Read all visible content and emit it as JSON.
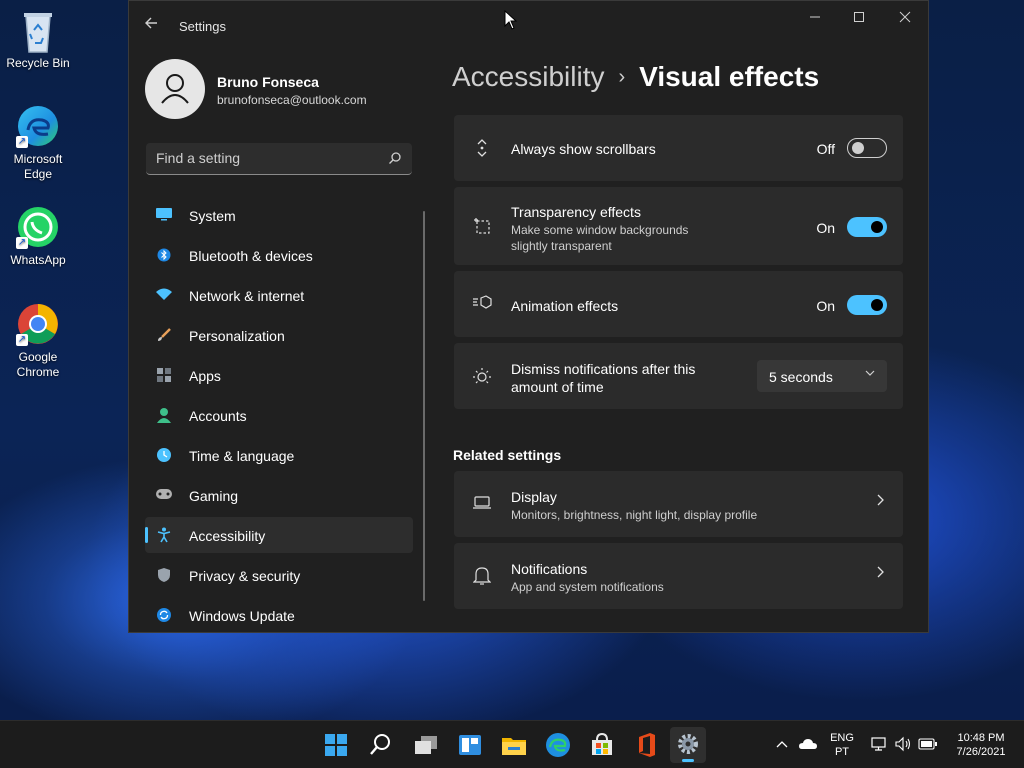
{
  "desktop": {
    "icons": [
      {
        "label": "Recycle Bin",
        "icon": "recycle-bin-icon"
      },
      {
        "label": "Microsoft Edge",
        "icon": "edge-icon"
      },
      {
        "label": "WhatsApp",
        "icon": "whatsapp-icon"
      },
      {
        "label": "Google Chrome",
        "icon": "chrome-icon"
      }
    ]
  },
  "window": {
    "title": "Settings",
    "profile": {
      "name": "Bruno Fonseca",
      "email": "brunofonseca@outlook.com"
    },
    "search": {
      "placeholder": "Find a setting"
    },
    "nav": [
      {
        "label": "System",
        "icon": "system-icon",
        "color": "#4cc2ff"
      },
      {
        "label": "Bluetooth & devices",
        "icon": "bluetooth-icon",
        "color": "#4cc2ff"
      },
      {
        "label": "Network & internet",
        "icon": "network-icon",
        "color": "#4cc2ff"
      },
      {
        "label": "Personalization",
        "icon": "personalization-icon",
        "color": "#e8a05a"
      },
      {
        "label": "Apps",
        "icon": "apps-icon",
        "color": "#9aa3ad"
      },
      {
        "label": "Accounts",
        "icon": "accounts-icon",
        "color": "#3ec08a"
      },
      {
        "label": "Time & language",
        "icon": "time-language-icon",
        "color": "#4cc2ff"
      },
      {
        "label": "Gaming",
        "icon": "gaming-icon",
        "color": "#b0b0b0"
      },
      {
        "label": "Accessibility",
        "icon": "accessibility-icon",
        "color": "#4cc2ff",
        "active": true
      },
      {
        "label": "Privacy & security",
        "icon": "privacy-icon",
        "color": "#9aa3ad"
      },
      {
        "label": "Windows Update",
        "icon": "windows-update-icon",
        "color": "#4cc2ff"
      }
    ],
    "breadcrumb": {
      "parent": "Accessibility",
      "separator": "›",
      "current": "Visual effects"
    },
    "settings": {
      "scrollbars": {
        "title": "Always show scrollbars",
        "state": "Off"
      },
      "transparency": {
        "title": "Transparency effects",
        "desc": "Make some window backgrounds slightly transparent",
        "state": "On"
      },
      "animation": {
        "title": "Animation effects",
        "state": "On"
      },
      "dismiss": {
        "title": "Dismiss notifications after this amount of time",
        "value": "5 seconds"
      }
    },
    "related": {
      "heading": "Related settings",
      "display": {
        "title": "Display",
        "desc": "Monitors, brightness, night light, display profile"
      },
      "notifications": {
        "title": "Notifications",
        "desc": "App and system notifications"
      }
    }
  },
  "taskbar": {
    "apps": [
      "start-icon",
      "search-icon",
      "task-view-icon",
      "widgets-icon",
      "file-explorer-icon",
      "edge-icon",
      "store-icon",
      "office-icon",
      "settings-icon"
    ],
    "tray": {
      "lang": "ENG",
      "layout": "PT",
      "time": "10:48 PM",
      "date": "7/26/2021"
    }
  },
  "colors": {
    "accent": "#4cc2ff",
    "window_bg": "#202020",
    "card_bg": "#2b2b2b"
  }
}
